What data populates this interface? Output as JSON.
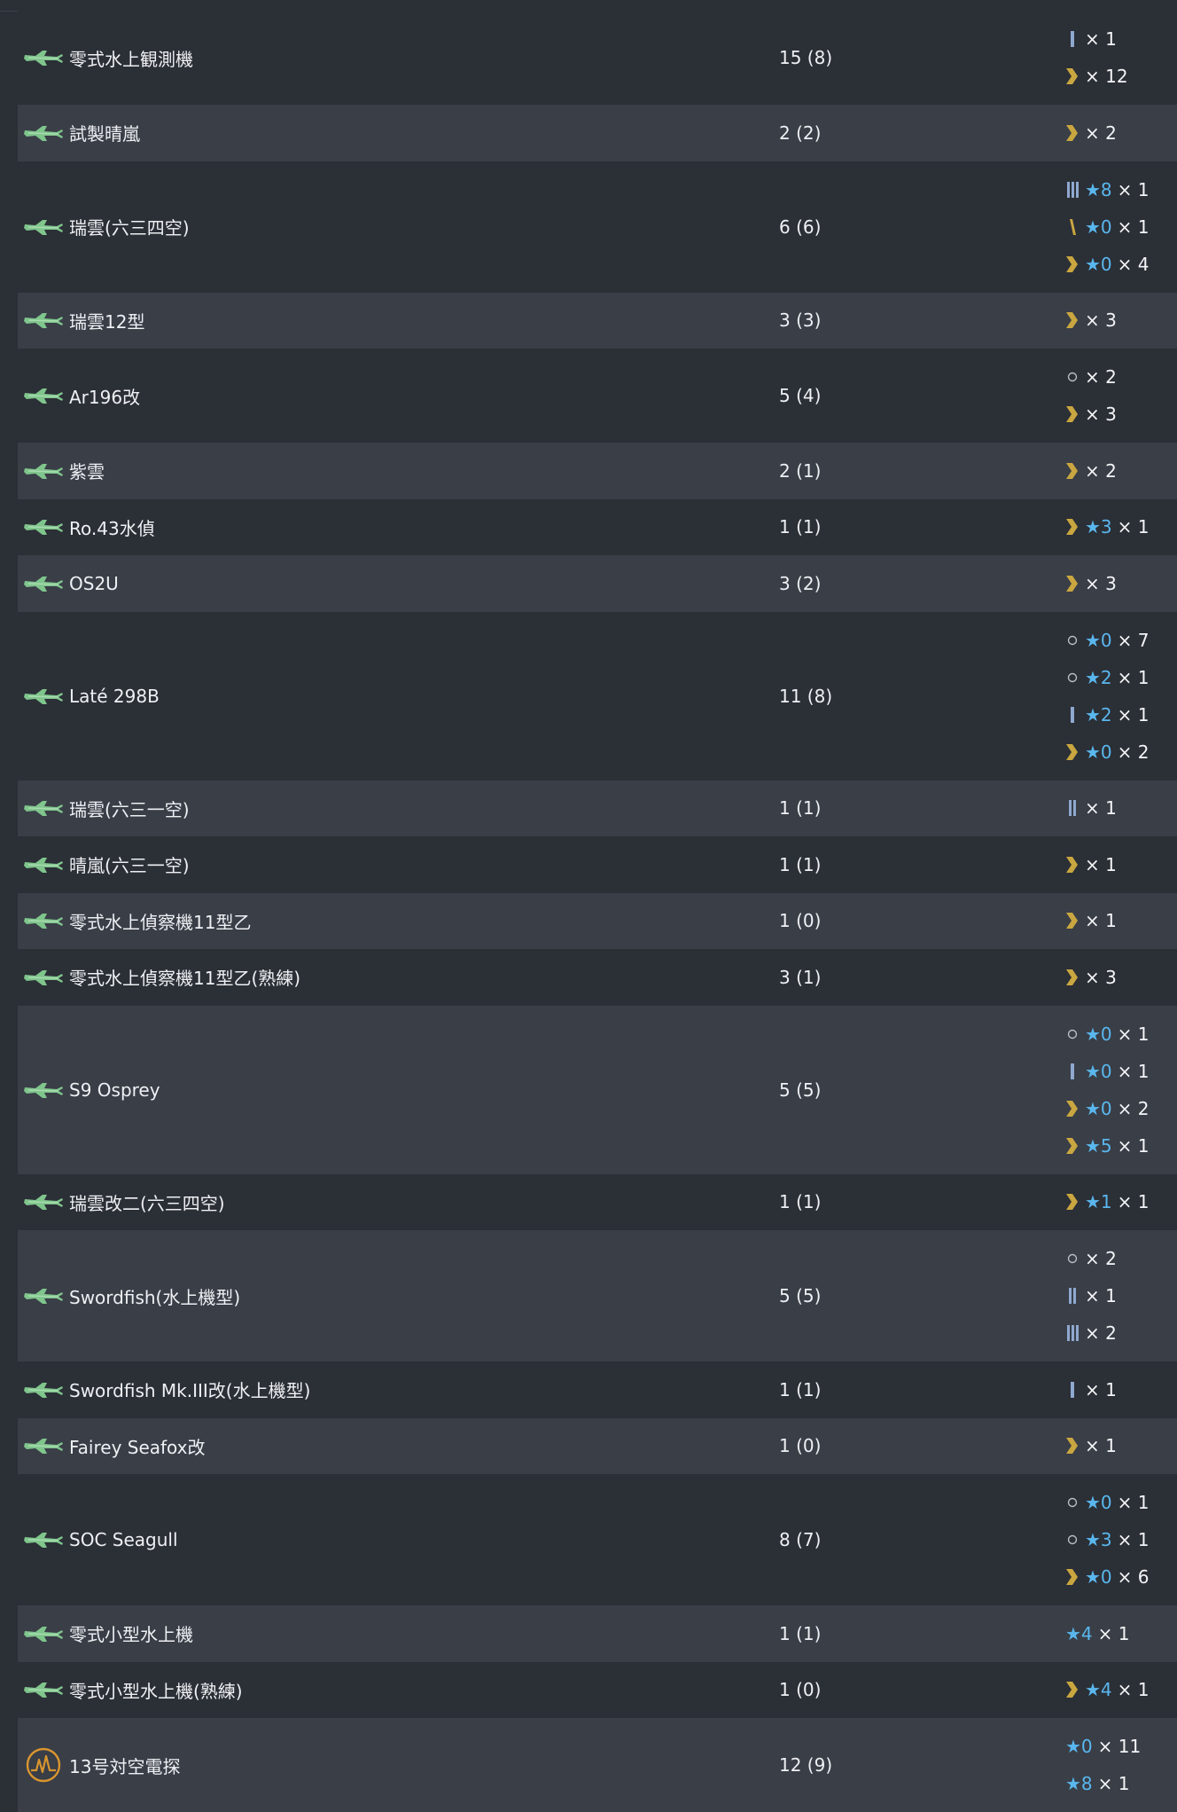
{
  "colors": {
    "background": "#2b2f36",
    "row_alt": "#393e47",
    "text": "#eef0f3",
    "star": "#5ab7ee",
    "chevron": "#c9a640",
    "bar": "#8fa8cf",
    "plane_icon": "#7fc58c",
    "radar_icon": "#d9952e"
  },
  "rows": [
    {
      "name": "零式水上観測機",
      "icon": "seaplane-icon",
      "count": "15 (8)",
      "details": [
        {
          "prof": "bar1",
          "star": "",
          "mult": "× 1"
        },
        {
          "prof": "chevron",
          "star": "",
          "mult": "× 12"
        }
      ]
    },
    {
      "name": "試製晴嵐",
      "icon": "seaplane-icon",
      "count": "2 (2)",
      "details": [
        {
          "prof": "chevron",
          "star": "",
          "mult": "× 2"
        }
      ]
    },
    {
      "name": "瑞雲(六三四空)",
      "icon": "seaplane-icon",
      "count": "6 (6)",
      "details": [
        {
          "prof": "bar3",
          "star": "★8",
          "mult": "× 1"
        },
        {
          "prof": "slash",
          "star": "★0",
          "mult": "× 1"
        },
        {
          "prof": "chevron",
          "star": "★0",
          "mult": "× 4"
        }
      ]
    },
    {
      "name": "瑞雲12型",
      "icon": "seaplane-icon",
      "count": "3 (3)",
      "details": [
        {
          "prof": "chevron",
          "star": "",
          "mult": "× 3"
        }
      ]
    },
    {
      "name": "Ar196改",
      "icon": "seaplane-icon",
      "count": "5 (4)",
      "details": [
        {
          "prof": "circle",
          "star": "",
          "mult": "× 2"
        },
        {
          "prof": "chevron",
          "star": "",
          "mult": "× 3"
        }
      ]
    },
    {
      "name": "紫雲",
      "icon": "seaplane-icon",
      "count": "2 (1)",
      "details": [
        {
          "prof": "chevron",
          "star": "",
          "mult": "× 2"
        }
      ]
    },
    {
      "name": "Ro.43水偵",
      "icon": "seaplane-icon",
      "count": "1 (1)",
      "details": [
        {
          "prof": "chevron",
          "star": "★3",
          "mult": "× 1"
        }
      ]
    },
    {
      "name": "OS2U",
      "icon": "seaplane-icon",
      "count": "3 (2)",
      "details": [
        {
          "prof": "chevron",
          "star": "",
          "mult": "× 3"
        }
      ]
    },
    {
      "name": "Laté 298B",
      "icon": "seaplane-icon",
      "count": "11 (8)",
      "details": [
        {
          "prof": "circle",
          "star": "★0",
          "mult": "× 7"
        },
        {
          "prof": "circle",
          "star": "★2",
          "mult": "× 1"
        },
        {
          "prof": "bar1",
          "star": "★2",
          "mult": "× 1"
        },
        {
          "prof": "chevron",
          "star": "★0",
          "mult": "× 2"
        }
      ]
    },
    {
      "name": "瑞雲(六三一空)",
      "icon": "seaplane-icon",
      "count": "1 (1)",
      "details": [
        {
          "prof": "bar2",
          "star": "",
          "mult": "× 1"
        }
      ]
    },
    {
      "name": "晴嵐(六三一空)",
      "icon": "seaplane-icon",
      "count": "1 (1)",
      "details": [
        {
          "prof": "chevron",
          "star": "",
          "mult": "× 1"
        }
      ]
    },
    {
      "name": "零式水上偵察機11型乙",
      "icon": "seaplane-icon",
      "count": "1 (0)",
      "details": [
        {
          "prof": "chevron",
          "star": "",
          "mult": "× 1"
        }
      ]
    },
    {
      "name": "零式水上偵察機11型乙(熟練)",
      "icon": "seaplane-icon",
      "count": "3 (1)",
      "details": [
        {
          "prof": "chevron",
          "star": "",
          "mult": "× 3"
        }
      ]
    },
    {
      "name": "S9 Osprey",
      "icon": "seaplane-icon",
      "count": "5 (5)",
      "details": [
        {
          "prof": "circle",
          "star": "★0",
          "mult": "× 1"
        },
        {
          "prof": "bar1",
          "star": "★0",
          "mult": "× 1"
        },
        {
          "prof": "chevron",
          "star": "★0",
          "mult": "× 2"
        },
        {
          "prof": "chevron",
          "star": "★5",
          "mult": "× 1"
        }
      ]
    },
    {
      "name": "瑞雲改二(六三四空)",
      "icon": "seaplane-icon",
      "count": "1 (1)",
      "details": [
        {
          "prof": "chevron",
          "star": "★1",
          "mult": "× 1"
        }
      ]
    },
    {
      "name": "Swordfish(水上機型)",
      "icon": "seaplane-icon",
      "count": "5 (5)",
      "details": [
        {
          "prof": "circle",
          "star": "",
          "mult": "× 2"
        },
        {
          "prof": "bar2",
          "star": "",
          "mult": "× 1"
        },
        {
          "prof": "bar3",
          "star": "",
          "mult": "× 2"
        }
      ]
    },
    {
      "name": "Swordfish Mk.III改(水上機型)",
      "icon": "seaplane-icon",
      "count": "1 (1)",
      "details": [
        {
          "prof": "bar1",
          "star": "",
          "mult": "× 1"
        }
      ]
    },
    {
      "name": "Fairey Seafox改",
      "icon": "seaplane-icon",
      "count": "1 (0)",
      "details": [
        {
          "prof": "chevron",
          "star": "",
          "mult": "× 1"
        }
      ]
    },
    {
      "name": "SOC Seagull",
      "icon": "seaplane-icon",
      "count": "8 (7)",
      "details": [
        {
          "prof": "circle",
          "star": "★0",
          "mult": "× 1"
        },
        {
          "prof": "circle",
          "star": "★3",
          "mult": "× 1"
        },
        {
          "prof": "chevron",
          "star": "★0",
          "mult": "× 6"
        }
      ]
    },
    {
      "name": "零式小型水上機",
      "icon": "seaplane-icon",
      "count": "1 (1)",
      "details": [
        {
          "prof": "none",
          "star": "★4",
          "mult": "× 1"
        }
      ]
    },
    {
      "name": "零式小型水上機(熟練)",
      "icon": "seaplane-icon",
      "count": "1 (0)",
      "details": [
        {
          "prof": "chevron",
          "star": "★4",
          "mult": "× 1"
        }
      ]
    },
    {
      "name": "13号対空電探",
      "icon": "radar-icon",
      "count": "12 (9)",
      "details": [
        {
          "prof": "none",
          "star": "★0",
          "mult": "× 11"
        },
        {
          "prof": "none",
          "star": "★8",
          "mult": "× 1"
        }
      ]
    }
  ]
}
